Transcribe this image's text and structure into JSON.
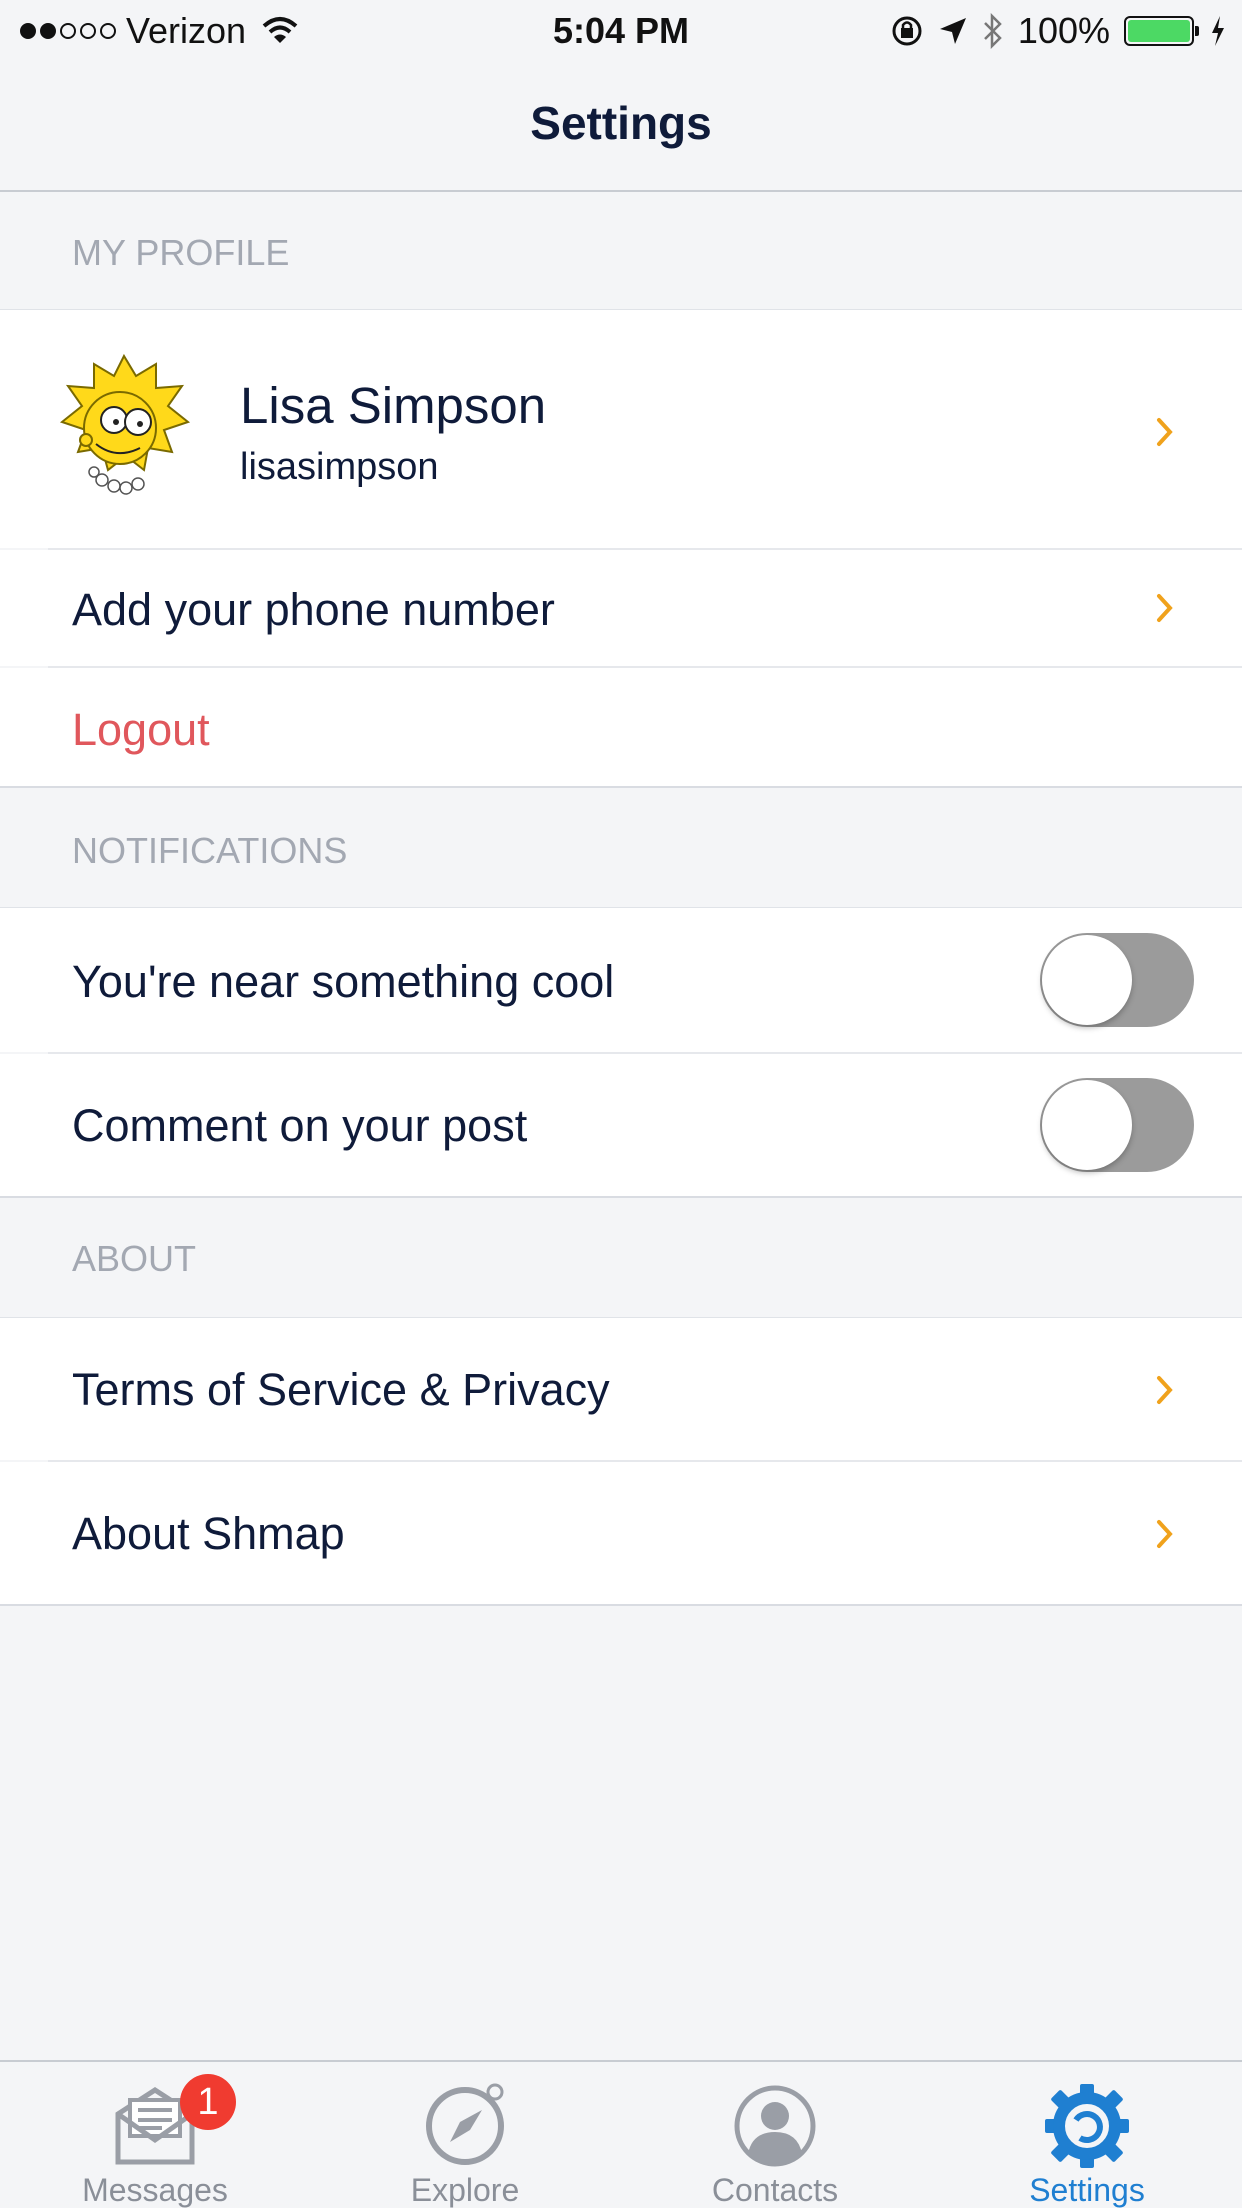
{
  "status_bar": {
    "carrier": "Verizon",
    "time": "5:04 PM",
    "battery_percent": "100%",
    "signal_bars_filled": 2,
    "signal_bars_total": 5
  },
  "nav": {
    "title": "Settings"
  },
  "profile_section": {
    "header": "MY PROFILE",
    "name": "Lisa Simpson",
    "username": "lisasimpson",
    "phone_label": "Add your phone number",
    "logout_label": "Logout"
  },
  "notifications_section": {
    "header": "NOTIFICATIONS",
    "items": [
      {
        "label": "You're near something cool",
        "enabled": false
      },
      {
        "label": "Comment on your post",
        "enabled": false
      }
    ]
  },
  "about_section": {
    "header": "ABOUT",
    "items": [
      {
        "label": "Terms of Service & Privacy"
      },
      {
        "label": "About Shmap"
      }
    ]
  },
  "tab_bar": {
    "tabs": [
      {
        "label": "Messages",
        "icon": "envelope-icon",
        "badge": "1",
        "active": false
      },
      {
        "label": "Explore",
        "icon": "compass-icon",
        "active": false
      },
      {
        "label": "Contacts",
        "icon": "person-icon",
        "active": false
      },
      {
        "label": "Settings",
        "icon": "gear-icon",
        "active": true
      }
    ]
  },
  "colors": {
    "accent": "#1f7fd1",
    "chevron": "#f0a21c",
    "danger": "#e0575c",
    "toggle_off": "#9b9b9b",
    "battery": "#4cd964"
  }
}
